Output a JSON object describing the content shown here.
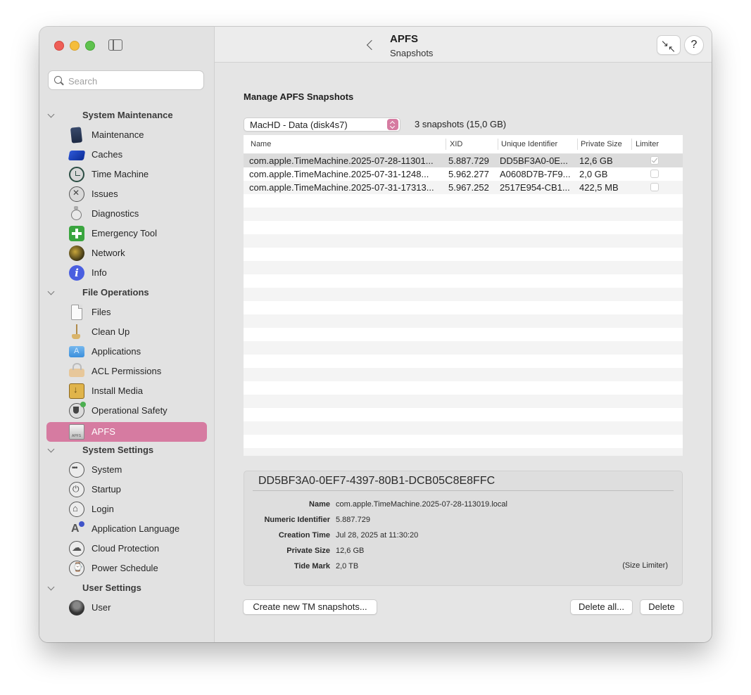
{
  "sidebar": {
    "search_placeholder": "Search",
    "sections": [
      {
        "label": "System Maintenance",
        "items": [
          {
            "label": "Maintenance",
            "icon": "maintenance-icon"
          },
          {
            "label": "Caches",
            "icon": "caches-icon"
          },
          {
            "label": "Time Machine",
            "icon": "time-machine-icon"
          },
          {
            "label": "Issues",
            "icon": "issues-icon"
          },
          {
            "label": "Diagnostics",
            "icon": "diagnostics-icon"
          },
          {
            "label": "Emergency Tool",
            "icon": "emergency-tool-icon"
          },
          {
            "label": "Network",
            "icon": "network-icon"
          },
          {
            "label": "Info",
            "icon": "info-icon"
          }
        ]
      },
      {
        "label": "File Operations",
        "items": [
          {
            "label": "Files",
            "icon": "files-icon"
          },
          {
            "label": "Clean Up",
            "icon": "clean-up-icon"
          },
          {
            "label": "Applications",
            "icon": "applications-icon"
          },
          {
            "label": "ACL Permissions",
            "icon": "acl-permissions-icon"
          },
          {
            "label": "Install Media",
            "icon": "install-media-icon"
          },
          {
            "label": "Operational Safety",
            "icon": "operational-safety-icon"
          },
          {
            "label": "APFS",
            "icon": "apfs-icon",
            "selected": true
          }
        ]
      },
      {
        "label": "System Settings",
        "items": [
          {
            "label": "System",
            "icon": "system-icon"
          },
          {
            "label": "Startup",
            "icon": "startup-icon"
          },
          {
            "label": "Login",
            "icon": "login-icon"
          },
          {
            "label": "Application Language",
            "icon": "application-language-icon"
          },
          {
            "label": "Cloud Protection",
            "icon": "cloud-protection-icon"
          },
          {
            "label": "Power Schedule",
            "icon": "power-schedule-icon"
          }
        ]
      },
      {
        "label": "User Settings",
        "items": [
          {
            "label": "User",
            "icon": "user-icon"
          }
        ]
      }
    ]
  },
  "header": {
    "title": "APFS",
    "subtitle": "Snapshots",
    "help_label": "?"
  },
  "main": {
    "section_title": "Manage APFS Snapshots",
    "volume_select": "MacHD - Data (disk4s7)",
    "snapshot_count": "3 snapshots (15,0 GB)",
    "table": {
      "columns": [
        "Name",
        "XID",
        "Unique Identifier",
        "Private Size",
        "Limiter"
      ],
      "rows": [
        {
          "name": "com.apple.TimeMachine.2025-07-28-11301...",
          "xid": "5.887.729",
          "uid": "DD5BF3A0-0E...",
          "size": "12,6 GB",
          "limiter": true
        },
        {
          "name": "com.apple.TimeMachine.2025-07-31-1248...",
          "xid": "5.962.277",
          "uid": "A0608D7B-7F9...",
          "size": "2,0 GB",
          "limiter": false
        },
        {
          "name": "com.apple.TimeMachine.2025-07-31-17313...",
          "xid": "5.967.252",
          "uid": "2517E954-CB1...",
          "size": "422,5 MB",
          "limiter": false
        }
      ]
    },
    "detail": {
      "uuid": "DD5BF3A0-0EF7-4397-80B1-DCB05C8E8FFC",
      "fields": [
        {
          "label": "Name",
          "value": "com.apple.TimeMachine.2025-07-28-113019.local"
        },
        {
          "label": "Numeric Identifier",
          "value": "5.887.729"
        },
        {
          "label": "Creation Time",
          "value": "Jul 28, 2025 at 11:30:20"
        },
        {
          "label": "Private Size",
          "value": "12,6 GB"
        },
        {
          "label": "Tide Mark",
          "value": "2,0 TB"
        }
      ],
      "size_limiter": "(Size Limiter)"
    },
    "buttons": {
      "create": "Create new TM snapshots...",
      "delete_all": "Delete all...",
      "delete": "Delete"
    }
  },
  "colors": {
    "accent": "#d67ba1",
    "sidebar_bg": "#e2e2e2",
    "content_bg": "#e5e5e5"
  }
}
